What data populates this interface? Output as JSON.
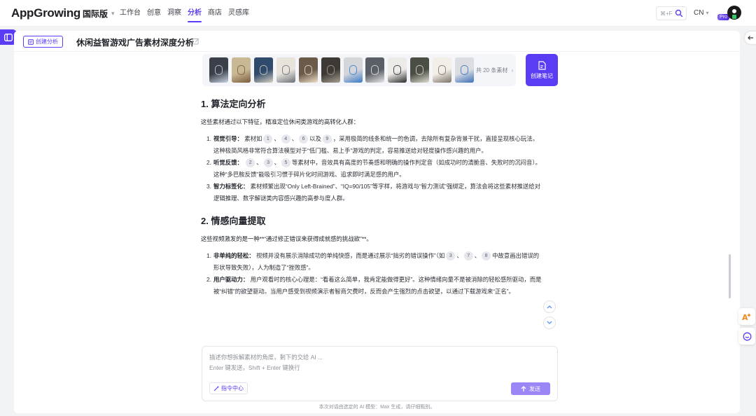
{
  "brand": {
    "name": "AppGrowing",
    "region": "国际版"
  },
  "nav": {
    "items": [
      {
        "label": "工作台",
        "active": false
      },
      {
        "label": "创意",
        "active": false
      },
      {
        "label": "洞察",
        "active": false
      },
      {
        "label": "分析",
        "active": true
      },
      {
        "label": "商店",
        "active": false
      },
      {
        "label": "灵感库",
        "active": false
      }
    ]
  },
  "header": {
    "shortcut": "⌘+F",
    "language": "CN",
    "badge": "Pro"
  },
  "page": {
    "create_analysis": "创建分析",
    "title": "休闲益智游戏广告素材深度分析"
  },
  "materials": {
    "total": "共 20 条素材",
    "create_note": "创建笔记",
    "thumbnails": [
      {
        "bg": "#3a3f4a",
        "accent": "#c9d2e0"
      },
      {
        "bg": "#c9b894",
        "accent": "#7a5a3a"
      },
      {
        "bg": "#2f4a6b",
        "accent": "#d8d0c0"
      },
      {
        "bg": "#e8e4dc",
        "accent": "#6a6f78"
      },
      {
        "bg": "#6b5a4a",
        "accent": "#f0e0c8"
      },
      {
        "bg": "#3d3a36",
        "accent": "#a8a090"
      },
      {
        "bg": "#d4d6da",
        "accent": "#3a7ac8"
      },
      {
        "bg": "#5a5e66",
        "accent": "#e8e8e8"
      },
      {
        "bg": "#ecebe7",
        "accent": "#2a2a2a"
      },
      {
        "bg": "#4a4e44",
        "accent": "#e0ddd2"
      },
      {
        "bg": "#f2efe8",
        "accent": "#7a7064"
      },
      {
        "bg": "#dcdde2",
        "accent": "#3a6fb8"
      },
      {
        "bg": "#2c2f36",
        "accent": "#c8c8c8"
      }
    ]
  },
  "sections": {
    "s1": {
      "heading": "1. 算法定向分析",
      "intro": "这些素材通过以下特征，精准定位休闲类游戏的高转化人群：",
      "items": [
        {
          "num": "1.",
          "label": "视觉引导：",
          "t1": "素材如",
          "r1": "1",
          "t2": "、",
          "r2": "4",
          "t3": "、",
          "r3": "6",
          "t4": "以及",
          "r4": "9",
          "t5": "，采用极简的线条和统一的色调，去除所有复杂背景干扰，直接呈现核心玩法。这种极简风格非常符合算法模型对于“低门槛、易上手”游戏的判定，容易推送给对轻度操作感兴趣的用户。"
        },
        {
          "num": "2.",
          "label": "听觉反馈：",
          "r1": "2",
          "t1": "、",
          "r2": "3",
          "t2": "、",
          "r3": "5",
          "t3": "等素材中，音效具有高度的节奏感和明确的操作判定音（如成功时的清脆音、失败时的沉闷音）。这种“多巴胺反馈”能吸引习惯于碎片化时间游戏、追求即时满足感的用户。"
        },
        {
          "num": "3.",
          "label": "智力标签化：",
          "text": "素材频繁出现“Only Left-Brained”、“IQ=90/105”等字样，将游戏与“智力测试”强绑定，算法会将这些素材推送给对逻辑推理、数字解谜类内容感兴趣的高参与度人群。"
        }
      ]
    },
    "s2": {
      "heading": "2. 情感向量提取",
      "intro": "这些视频激发的是一种**“通过修正错误来获得成就感的挑战欲”**。",
      "items": [
        {
          "num": "1.",
          "label": "非单纯的轻松：",
          "t1": "视频并没有展示消除成功的单纯快感，而是通过展示“拙劣的错误操作”（如",
          "r1": "3",
          "t2": "、",
          "r2": "7",
          "t3": "、",
          "r3": "8",
          "t4": "中故意画出错误的形状导致失败），人为制造了“挫败感”。"
        },
        {
          "num": "2.",
          "label": "用户驱动力：",
          "text": "用户观看时的核心心理是：“看着这么简单，我肯定能做得更好”。这种情绪向量不是被消除的轻松感所驱动，而是被“纠错”的欲望驱动。当用户感受到视频演示者智商欠费时，反而会产生强烈的点击欲望，以通过下载游戏来“正名”。"
        }
      ]
    }
  },
  "chat": {
    "placeholder_line1": "描述你想拆解素材的角度，剩下的交给 AI ...",
    "placeholder_line2": "Enter 键发送，Shift + Enter 键换行",
    "command_center": "指令中心",
    "send": "发送",
    "footnote": "本次对话由选定的 AI 模型：Max 生成，请仔细甄别。"
  },
  "colors": {
    "accent": "#5b3cf5",
    "send_disabled": "#9b85f7"
  }
}
